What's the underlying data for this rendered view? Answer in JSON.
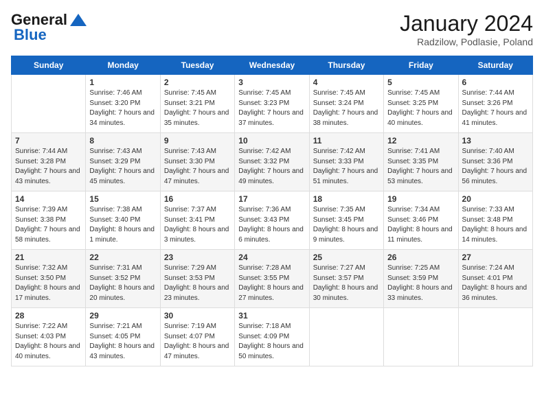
{
  "header": {
    "logo_line1": "General",
    "logo_line2": "Blue",
    "month": "January 2024",
    "location": "Radzilow, Podlasie, Poland"
  },
  "days_of_week": [
    "Sunday",
    "Monday",
    "Tuesday",
    "Wednesday",
    "Thursday",
    "Friday",
    "Saturday"
  ],
  "weeks": [
    [
      {
        "day": "",
        "sunrise": "",
        "sunset": "",
        "daylight": ""
      },
      {
        "day": "1",
        "sunrise": "Sunrise: 7:46 AM",
        "sunset": "Sunset: 3:20 PM",
        "daylight": "Daylight: 7 hours and 34 minutes."
      },
      {
        "day": "2",
        "sunrise": "Sunrise: 7:45 AM",
        "sunset": "Sunset: 3:21 PM",
        "daylight": "Daylight: 7 hours and 35 minutes."
      },
      {
        "day": "3",
        "sunrise": "Sunrise: 7:45 AM",
        "sunset": "Sunset: 3:23 PM",
        "daylight": "Daylight: 7 hours and 37 minutes."
      },
      {
        "day": "4",
        "sunrise": "Sunrise: 7:45 AM",
        "sunset": "Sunset: 3:24 PM",
        "daylight": "Daylight: 7 hours and 38 minutes."
      },
      {
        "day": "5",
        "sunrise": "Sunrise: 7:45 AM",
        "sunset": "Sunset: 3:25 PM",
        "daylight": "Daylight: 7 hours and 40 minutes."
      },
      {
        "day": "6",
        "sunrise": "Sunrise: 7:44 AM",
        "sunset": "Sunset: 3:26 PM",
        "daylight": "Daylight: 7 hours and 41 minutes."
      }
    ],
    [
      {
        "day": "7",
        "sunrise": "Sunrise: 7:44 AM",
        "sunset": "Sunset: 3:28 PM",
        "daylight": "Daylight: 7 hours and 43 minutes."
      },
      {
        "day": "8",
        "sunrise": "Sunrise: 7:43 AM",
        "sunset": "Sunset: 3:29 PM",
        "daylight": "Daylight: 7 hours and 45 minutes."
      },
      {
        "day": "9",
        "sunrise": "Sunrise: 7:43 AM",
        "sunset": "Sunset: 3:30 PM",
        "daylight": "Daylight: 7 hours and 47 minutes."
      },
      {
        "day": "10",
        "sunrise": "Sunrise: 7:42 AM",
        "sunset": "Sunset: 3:32 PM",
        "daylight": "Daylight: 7 hours and 49 minutes."
      },
      {
        "day": "11",
        "sunrise": "Sunrise: 7:42 AM",
        "sunset": "Sunset: 3:33 PM",
        "daylight": "Daylight: 7 hours and 51 minutes."
      },
      {
        "day": "12",
        "sunrise": "Sunrise: 7:41 AM",
        "sunset": "Sunset: 3:35 PM",
        "daylight": "Daylight: 7 hours and 53 minutes."
      },
      {
        "day": "13",
        "sunrise": "Sunrise: 7:40 AM",
        "sunset": "Sunset: 3:36 PM",
        "daylight": "Daylight: 7 hours and 56 minutes."
      }
    ],
    [
      {
        "day": "14",
        "sunrise": "Sunrise: 7:39 AM",
        "sunset": "Sunset: 3:38 PM",
        "daylight": "Daylight: 7 hours and 58 minutes."
      },
      {
        "day": "15",
        "sunrise": "Sunrise: 7:38 AM",
        "sunset": "Sunset: 3:40 PM",
        "daylight": "Daylight: 8 hours and 1 minute."
      },
      {
        "day": "16",
        "sunrise": "Sunrise: 7:37 AM",
        "sunset": "Sunset: 3:41 PM",
        "daylight": "Daylight: 8 hours and 3 minutes."
      },
      {
        "day": "17",
        "sunrise": "Sunrise: 7:36 AM",
        "sunset": "Sunset: 3:43 PM",
        "daylight": "Daylight: 8 hours and 6 minutes."
      },
      {
        "day": "18",
        "sunrise": "Sunrise: 7:35 AM",
        "sunset": "Sunset: 3:45 PM",
        "daylight": "Daylight: 8 hours and 9 minutes."
      },
      {
        "day": "19",
        "sunrise": "Sunrise: 7:34 AM",
        "sunset": "Sunset: 3:46 PM",
        "daylight": "Daylight: 8 hours and 11 minutes."
      },
      {
        "day": "20",
        "sunrise": "Sunrise: 7:33 AM",
        "sunset": "Sunset: 3:48 PM",
        "daylight": "Daylight: 8 hours and 14 minutes."
      }
    ],
    [
      {
        "day": "21",
        "sunrise": "Sunrise: 7:32 AM",
        "sunset": "Sunset: 3:50 PM",
        "daylight": "Daylight: 8 hours and 17 minutes."
      },
      {
        "day": "22",
        "sunrise": "Sunrise: 7:31 AM",
        "sunset": "Sunset: 3:52 PM",
        "daylight": "Daylight: 8 hours and 20 minutes."
      },
      {
        "day": "23",
        "sunrise": "Sunrise: 7:29 AM",
        "sunset": "Sunset: 3:53 PM",
        "daylight": "Daylight: 8 hours and 23 minutes."
      },
      {
        "day": "24",
        "sunrise": "Sunrise: 7:28 AM",
        "sunset": "Sunset: 3:55 PM",
        "daylight": "Daylight: 8 hours and 27 minutes."
      },
      {
        "day": "25",
        "sunrise": "Sunrise: 7:27 AM",
        "sunset": "Sunset: 3:57 PM",
        "daylight": "Daylight: 8 hours and 30 minutes."
      },
      {
        "day": "26",
        "sunrise": "Sunrise: 7:25 AM",
        "sunset": "Sunset: 3:59 PM",
        "daylight": "Daylight: 8 hours and 33 minutes."
      },
      {
        "day": "27",
        "sunrise": "Sunrise: 7:24 AM",
        "sunset": "Sunset: 4:01 PM",
        "daylight": "Daylight: 8 hours and 36 minutes."
      }
    ],
    [
      {
        "day": "28",
        "sunrise": "Sunrise: 7:22 AM",
        "sunset": "Sunset: 4:03 PM",
        "daylight": "Daylight: 8 hours and 40 minutes."
      },
      {
        "day": "29",
        "sunrise": "Sunrise: 7:21 AM",
        "sunset": "Sunset: 4:05 PM",
        "daylight": "Daylight: 8 hours and 43 minutes."
      },
      {
        "day": "30",
        "sunrise": "Sunrise: 7:19 AM",
        "sunset": "Sunset: 4:07 PM",
        "daylight": "Daylight: 8 hours and 47 minutes."
      },
      {
        "day": "31",
        "sunrise": "Sunrise: 7:18 AM",
        "sunset": "Sunset: 4:09 PM",
        "daylight": "Daylight: 8 hours and 50 minutes."
      },
      {
        "day": "",
        "sunrise": "",
        "sunset": "",
        "daylight": ""
      },
      {
        "day": "",
        "sunrise": "",
        "sunset": "",
        "daylight": ""
      },
      {
        "day": "",
        "sunrise": "",
        "sunset": "",
        "daylight": ""
      }
    ]
  ]
}
